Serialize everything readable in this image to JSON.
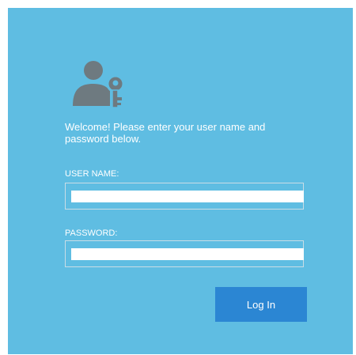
{
  "login": {
    "welcome_text": "Welcome! Please enter your user name and password below.",
    "username_label": "USER NAME:",
    "username_value": "",
    "password_label": "PASSWORD:",
    "password_value": "",
    "login_button_label": "Log In"
  },
  "colors": {
    "panel_background": "#5fbde2",
    "icon": "#6e7a80",
    "button": "#2b86d3",
    "text": "#ffffff"
  },
  "icons": {
    "header_icon": "user-key-icon"
  }
}
